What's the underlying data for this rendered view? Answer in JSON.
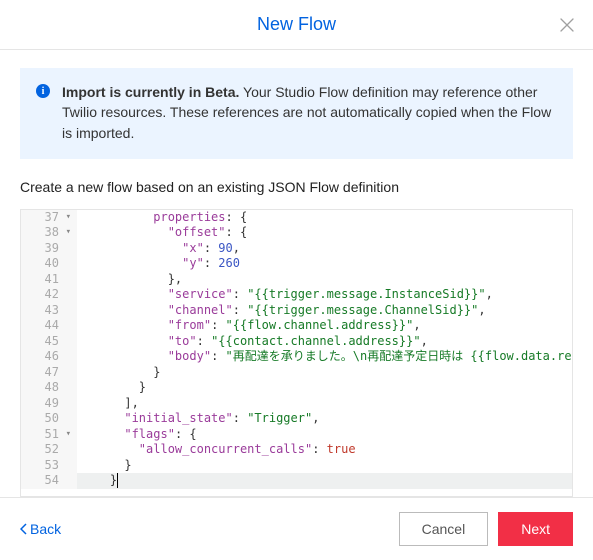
{
  "header": {
    "title": "New Flow"
  },
  "banner": {
    "strong": "Import is currently in Beta.",
    "rest": " Your Studio Flow definition may reference other Twilio resources. These references are not automatically copied when the Flow is imported."
  },
  "subtitle": "Create a new flow based on an existing JSON Flow definition",
  "code": {
    "lines": [
      {
        "num": "37",
        "fold": true,
        "indent": 10,
        "tokens": [
          [
            "k",
            "properties"
          ],
          [
            "p",
            ": {"
          ]
        ]
      },
      {
        "num": "38",
        "fold": true,
        "indent": 12,
        "tokens": [
          [
            "k",
            "\"offset\""
          ],
          [
            "p",
            ": {"
          ]
        ]
      },
      {
        "num": "39",
        "fold": false,
        "indent": 14,
        "tokens": [
          [
            "k",
            "\"x\""
          ],
          [
            "p",
            ": "
          ],
          [
            "n",
            "90"
          ],
          [
            "p",
            ","
          ]
        ]
      },
      {
        "num": "40",
        "fold": false,
        "indent": 14,
        "tokens": [
          [
            "k",
            "\"y\""
          ],
          [
            "p",
            ": "
          ],
          [
            "n",
            "260"
          ]
        ]
      },
      {
        "num": "41",
        "fold": false,
        "indent": 12,
        "tokens": [
          [
            "p",
            "},"
          ]
        ]
      },
      {
        "num": "42",
        "fold": false,
        "indent": 12,
        "tokens": [
          [
            "k",
            "\"service\""
          ],
          [
            "p",
            ": "
          ],
          [
            "s",
            "\"{{trigger.message.InstanceSid}}\""
          ],
          [
            "p",
            ","
          ]
        ]
      },
      {
        "num": "43",
        "fold": false,
        "indent": 12,
        "tokens": [
          [
            "k",
            "\"channel\""
          ],
          [
            "p",
            ": "
          ],
          [
            "s",
            "\"{{trigger.message.ChannelSid}}\""
          ],
          [
            "p",
            ","
          ]
        ]
      },
      {
        "num": "44",
        "fold": false,
        "indent": 12,
        "tokens": [
          [
            "k",
            "\"from\""
          ],
          [
            "p",
            ": "
          ],
          [
            "s",
            "\"{{flow.channel.address}}\""
          ],
          [
            "p",
            ","
          ]
        ]
      },
      {
        "num": "45",
        "fold": false,
        "indent": 12,
        "tokens": [
          [
            "k",
            "\"to\""
          ],
          [
            "p",
            ": "
          ],
          [
            "s",
            "\"{{contact.channel.address}}\""
          ],
          [
            "p",
            ","
          ]
        ]
      },
      {
        "num": "46",
        "fold": false,
        "indent": 12,
        "tokens": [
          [
            "k",
            "\"body\""
          ],
          [
            "p",
            ": "
          ],
          [
            "s",
            "\"再配達を承りました。\\n再配達予定日時は {{flow.data.re"
          ]
        ]
      },
      {
        "num": "47",
        "fold": false,
        "indent": 10,
        "tokens": [
          [
            "p",
            "}"
          ]
        ]
      },
      {
        "num": "48",
        "fold": false,
        "indent": 8,
        "tokens": [
          [
            "p",
            "}"
          ]
        ]
      },
      {
        "num": "49",
        "fold": false,
        "indent": 6,
        "tokens": [
          [
            "p",
            "],"
          ]
        ]
      },
      {
        "num": "50",
        "fold": false,
        "indent": 6,
        "tokens": [
          [
            "k",
            "\"initial_state\""
          ],
          [
            "p",
            ": "
          ],
          [
            "s",
            "\"Trigger\""
          ],
          [
            "p",
            ","
          ]
        ]
      },
      {
        "num": "51",
        "fold": true,
        "indent": 6,
        "tokens": [
          [
            "k",
            "\"flags\""
          ],
          [
            "p",
            ": {"
          ]
        ]
      },
      {
        "num": "52",
        "fold": false,
        "indent": 8,
        "tokens": [
          [
            "k",
            "\"allow_concurrent_calls\""
          ],
          [
            "p",
            ": "
          ],
          [
            "b",
            "true"
          ]
        ]
      },
      {
        "num": "53",
        "fold": false,
        "indent": 6,
        "tokens": [
          [
            "p",
            "}"
          ]
        ]
      },
      {
        "num": "54",
        "fold": false,
        "indent": 4,
        "tokens": [
          [
            "p",
            "}"
          ]
        ],
        "active": true
      }
    ]
  },
  "footer": {
    "back": "Back",
    "cancel": "Cancel",
    "next": "Next"
  }
}
